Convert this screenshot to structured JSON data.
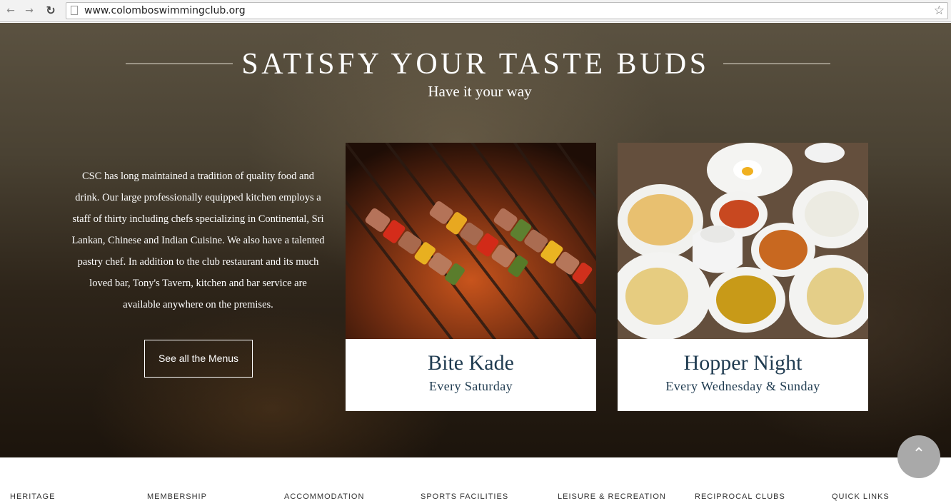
{
  "browser": {
    "url": "www.colomboswimmingclub.org"
  },
  "hero": {
    "title": "SATISFY YOUR TASTE BUDS",
    "subtitle": "Have it your way",
    "description": "CSC has long maintained a tradition of quality food and drink. Our large professionally equipped kitchen employs a staff of thirty including chefs specializing in Continental, Sri Lankan, Chinese and Indian Cuisine. We also have a talented pastry chef. In addition to the club restaurant and its much loved bar, Tony's Tavern, kitchen and bar service are available anywhere on the premises.",
    "button_label": "See all the Menus"
  },
  "cards": [
    {
      "title": "Bite Kade",
      "subtitle": "Every Saturday"
    },
    {
      "title": "Hopper Night",
      "subtitle": "Every Wednesday & Sunday"
    }
  ],
  "footer": {
    "links": [
      "HERITAGE",
      "MEMBERSHIP",
      "ACCOMMODATION",
      "SPORTS FACILITIES",
      "LEISURE & RECREATION",
      "RECIPROCAL CLUBS",
      "QUICK LINKS"
    ]
  },
  "icons": {
    "back": "arrow-left-icon",
    "forward": "arrow-right-icon",
    "reload": "reload-icon",
    "bookmark": "star-icon",
    "scroll_top": "chevron-up-icon"
  },
  "colors": {
    "card_text": "#1f3b50",
    "hero_bg_dark": "#1c140c",
    "scroll_button": "#a9a9a9"
  }
}
